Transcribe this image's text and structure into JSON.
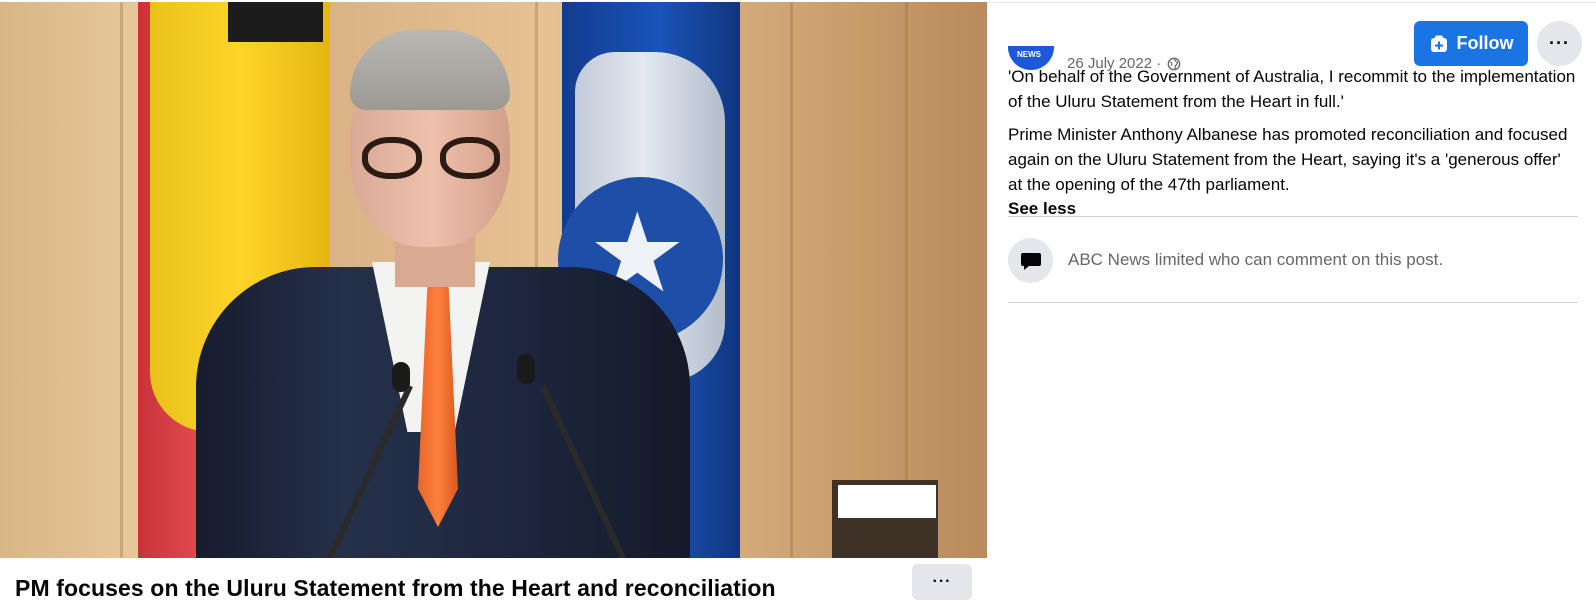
{
  "video": {
    "title": "PM focuses on the Uluru Statement from the Heart and reconciliation",
    "more_label": "···"
  },
  "post": {
    "avatar_text": "NEWS",
    "date": "26 July 2022 ·",
    "follow_label": "Follow",
    "more_label": "···",
    "quote": "'On behalf of the Government of Australia, I recommit to the implementation of the Uluru Statement from the Heart in full.'",
    "body": "Prime Minister Anthony Albanese has promoted reconciliation and focused again on the Uluru Statement from the Heart, saying it's a 'generous offer' at the opening of the 47th parliament.",
    "see_less_label": "See less",
    "comment_restriction": "ABC News limited who can comment on this post."
  },
  "colors": {
    "accent": "#1b74e4",
    "secondary_text": "#65676b",
    "button_bg": "#e4e6eb"
  },
  "icons": {
    "privacy": "globe-icon",
    "follow": "follow-plus-icon",
    "comment": "comment-bubble-icon"
  }
}
